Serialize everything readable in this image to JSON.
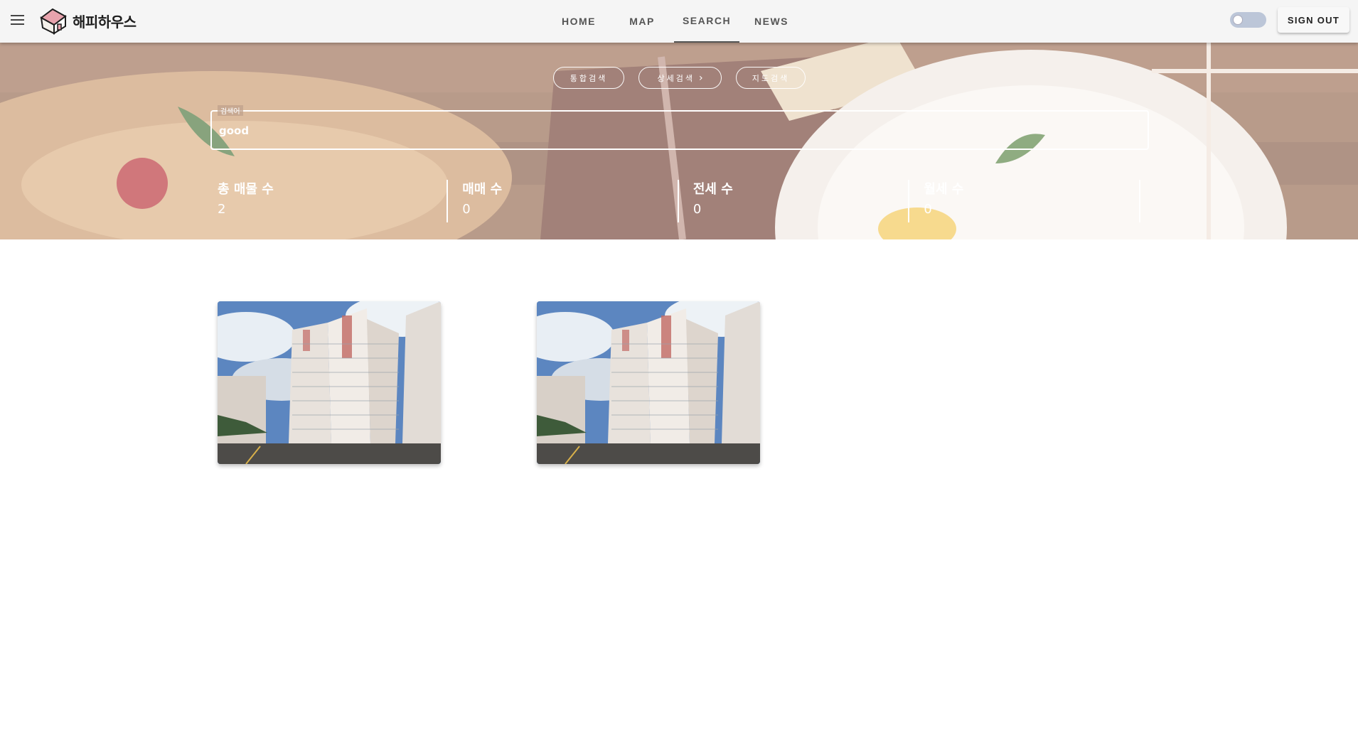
{
  "appbar": {
    "menu_icon": "hamburger-menu-icon",
    "logo_text": "해피하우스",
    "logo_icon": "house-icon",
    "nav": [
      {
        "label": "HOME"
      },
      {
        "label": "MAP"
      },
      {
        "label": "SEARCH",
        "active": true
      },
      {
        "label": "NEWS"
      }
    ],
    "theme_toggle": {
      "on": false
    },
    "signout_label": "SIGN OUT"
  },
  "hero": {
    "search_tabs": [
      {
        "label": "통합검색"
      },
      {
        "label": "상세검색",
        "icon": "chevron-right-icon"
      },
      {
        "label": "지도검색"
      }
    ],
    "search": {
      "label": "검색어",
      "value": "good"
    },
    "stats": [
      {
        "label": "총 매물 수",
        "value": "2"
      },
      {
        "label": "매매 수",
        "value": "0"
      },
      {
        "label": "전세 수",
        "value": "0"
      },
      {
        "label": "월세 수",
        "value": "0"
      }
    ]
  },
  "results": {
    "cards": [
      {
        "image": "apartment-building-photo"
      },
      {
        "image": "apartment-building-photo"
      }
    ]
  },
  "colors": {
    "appbar_bg": "#f5f5f5",
    "hero_overlay": "#ffffff",
    "toggle_track": "#bcc6d8"
  }
}
